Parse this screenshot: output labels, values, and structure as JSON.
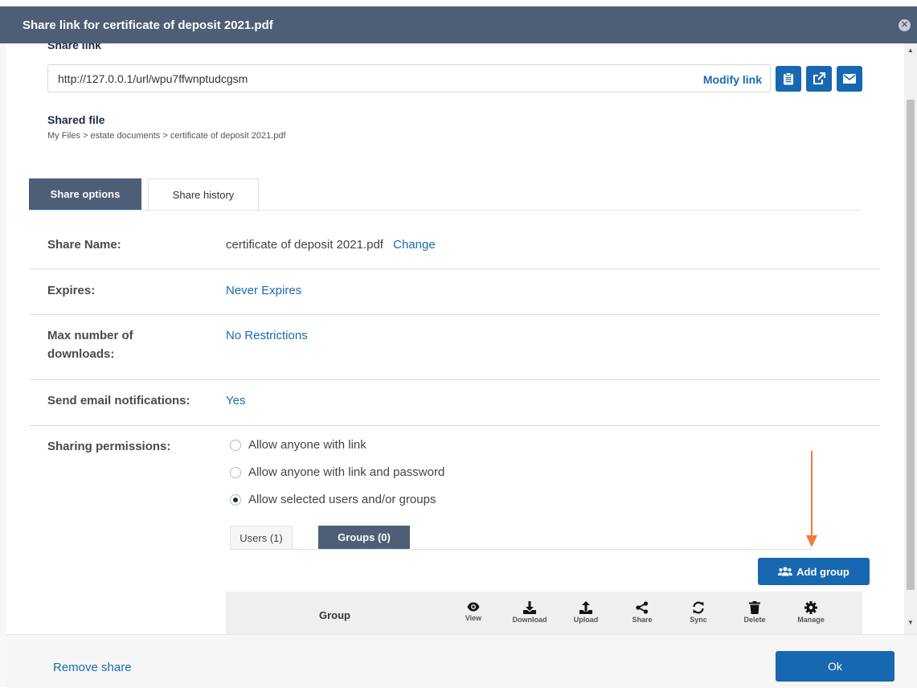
{
  "dialog": {
    "title": "Share link for certificate of deposit 2021.pdf"
  },
  "share_link": {
    "heading": "Share link",
    "url": "http://127.0.0.1/url/wpu7ffwnptudcgsm",
    "modify_label": "Modify link"
  },
  "shared_file": {
    "heading": "Shared file",
    "breadcrumb": "My Files > estate documents > certificate of deposit 2021.pdf"
  },
  "tabs": [
    {
      "label": "Share options",
      "active": true
    },
    {
      "label": "Share history",
      "active": false
    }
  ],
  "options": {
    "share_name_label": "Share Name:",
    "share_name_value": "certificate of deposit 2021.pdf",
    "change_label": "Change",
    "expires_label": "Expires:",
    "expires_value": "Never Expires",
    "max_downloads_label_1": "Max number of",
    "max_downloads_label_2": "downloads:",
    "max_downloads_value": "No Restrictions",
    "email_label": "Send email notifications:",
    "email_value": "Yes",
    "permissions_label": "Sharing permissions:",
    "permissions": [
      {
        "label": "Allow anyone with link",
        "checked": false
      },
      {
        "label": "Allow anyone with link and password",
        "checked": false
      },
      {
        "label": "Allow selected users and/or groups",
        "checked": true
      }
    ]
  },
  "subtabs": [
    {
      "label": "Users (1)",
      "active": false
    },
    {
      "label": "Groups (0)",
      "active": true
    }
  ],
  "add_group_label": "Add group",
  "table": {
    "group_header": "Group",
    "columns": [
      {
        "label": "View",
        "icon": "eye-icon"
      },
      {
        "label": "Download",
        "icon": "download-icon"
      },
      {
        "label": "Upload",
        "icon": "upload-icon"
      },
      {
        "label": "Share",
        "icon": "share-icon"
      },
      {
        "label": "Sync",
        "icon": "sync-icon"
      },
      {
        "label": "Delete",
        "icon": "trash-icon"
      },
      {
        "label": "Manage",
        "icon": "gear-icon"
      }
    ]
  },
  "footer": {
    "remove_label": "Remove share",
    "ok_label": "Ok"
  },
  "colors": {
    "header_bg": "#4d5e76",
    "primary_button": "#1868b1",
    "link": "#1b6bb0",
    "annotation_arrow": "#f47b3c"
  }
}
